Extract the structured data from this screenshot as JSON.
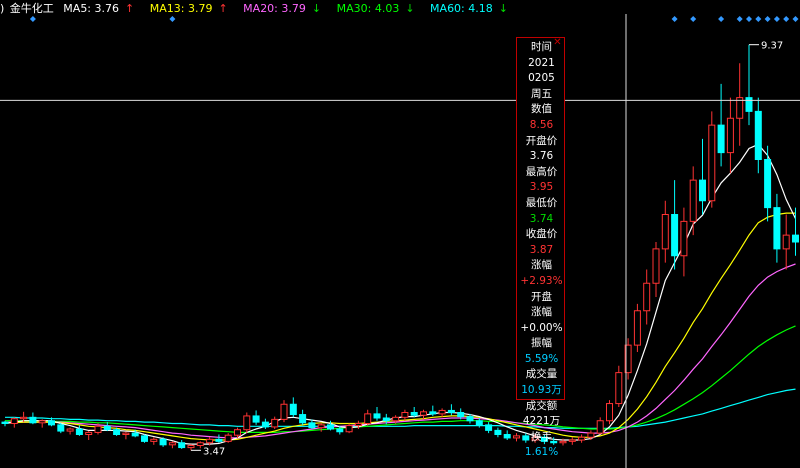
{
  "legend": {
    "prefix": ")",
    "stock_name": "金牛化工",
    "items": [
      {
        "label": "MA5: 3.76",
        "arrow": "↑",
        "color": "#ffffff"
      },
      {
        "label": "MA13: 3.79",
        "arrow": "↑",
        "color": "#ffff00"
      },
      {
        "label": "MA20: 3.79",
        "arrow": "↓",
        "color": "#ff66ff"
      },
      {
        "label": "MA30: 4.03",
        "arrow": "↓",
        "color": "#00ff00"
      },
      {
        "label": "MA60: 4.18",
        "arrow": "↓",
        "color": "#00ffff"
      }
    ]
  },
  "info_panel": {
    "close_glyph": "✕",
    "rows": [
      {
        "text": "时间",
        "color": "#ffffff"
      },
      {
        "text": "2021",
        "color": "#ffffff"
      },
      {
        "text": "0205",
        "color": "#ffffff"
      },
      {
        "text": "周五",
        "color": "#ffffff"
      },
      {
        "text": "数值",
        "color": "#ffffff"
      },
      {
        "text": "8.56",
        "color": "#ff3333"
      },
      {
        "text": "开盘价",
        "color": "#ffffff"
      },
      {
        "text": "3.76",
        "color": "#ffffff"
      },
      {
        "text": "最高价",
        "color": "#ffffff"
      },
      {
        "text": "3.95",
        "color": "#ff3333"
      },
      {
        "text": "最低价",
        "color": "#ffffff"
      },
      {
        "text": "3.74",
        "color": "#00dd00"
      },
      {
        "text": "收盘价",
        "color": "#ffffff"
      },
      {
        "text": "3.87",
        "color": "#ff3333"
      },
      {
        "text": "涨幅",
        "color": "#ffffff"
      },
      {
        "text": "+2.93%",
        "color": "#ff3333"
      },
      {
        "text": "开盘",
        "color": "#ffffff"
      },
      {
        "text": "涨幅",
        "color": "#ffffff"
      },
      {
        "text": "+0.00%",
        "color": "#ffffff"
      },
      {
        "text": "振幅",
        "color": "#ffffff"
      },
      {
        "text": "5.59%",
        "color": "#00ccff"
      },
      {
        "text": "成交量",
        "color": "#ffffff"
      },
      {
        "text": "10.93万",
        "color": "#00ccff"
      },
      {
        "text": "成交额",
        "color": "#ffffff"
      },
      {
        "text": "4221万",
        "color": "#ffffff"
      },
      {
        "text": "换手",
        "color": "#ffffff"
      },
      {
        "text": "1.61%",
        "color": "#00ccff"
      }
    ]
  },
  "chart_data": {
    "type": "candlestick",
    "ylim": [
      3.3,
      9.7
    ],
    "crosshair_value": 8.56,
    "annotations": [
      {
        "text": "9.37",
        "value": 9.37
      },
      {
        "text": "3.47",
        "value": 3.47
      }
    ],
    "colors": {
      "up": "#ff3333",
      "down": "#00ffff",
      "ma5": "#ffffff",
      "ma13": "#ffff00",
      "ma20": "#ff66ff",
      "ma30": "#00ff00",
      "ma60": "#00ffff",
      "marker": "#3399ff",
      "crosshair": "#dddddd"
    },
    "ohlc": [
      [
        3.88,
        3.9,
        3.82,
        3.86
      ],
      [
        3.86,
        3.95,
        3.8,
        3.93
      ],
      [
        3.93,
        4.03,
        3.88,
        3.95
      ],
      [
        3.95,
        4.02,
        3.85,
        3.87
      ],
      [
        3.87,
        3.92,
        3.8,
        3.9
      ],
      [
        3.9,
        3.95,
        3.82,
        3.84
      ],
      [
        3.84,
        3.87,
        3.72,
        3.75
      ],
      [
        3.75,
        3.8,
        3.7,
        3.78
      ],
      [
        3.78,
        3.83,
        3.68,
        3.7
      ],
      [
        3.7,
        3.75,
        3.62,
        3.73
      ],
      [
        3.73,
        3.86,
        3.7,
        3.82
      ],
      [
        3.82,
        3.88,
        3.75,
        3.77
      ],
      [
        3.77,
        3.8,
        3.68,
        3.7
      ],
      [
        3.7,
        3.74,
        3.63,
        3.72
      ],
      [
        3.72,
        3.77,
        3.66,
        3.68
      ],
      [
        3.68,
        3.7,
        3.58,
        3.6
      ],
      [
        3.6,
        3.66,
        3.55,
        3.63
      ],
      [
        3.63,
        3.66,
        3.52,
        3.55
      ],
      [
        3.55,
        3.6,
        3.5,
        3.58
      ],
      [
        3.58,
        3.62,
        3.49,
        3.51
      ],
      [
        3.51,
        3.56,
        3.47,
        3.54
      ],
      [
        3.54,
        3.6,
        3.5,
        3.58
      ],
      [
        3.58,
        3.66,
        3.54,
        3.63
      ],
      [
        3.63,
        3.7,
        3.58,
        3.6
      ],
      [
        3.6,
        3.72,
        3.58,
        3.69
      ],
      [
        3.69,
        3.8,
        3.65,
        3.77
      ],
      [
        3.77,
        4.02,
        3.72,
        3.97
      ],
      [
        3.97,
        4.05,
        3.84,
        3.88
      ],
      [
        3.88,
        3.93,
        3.78,
        3.81
      ],
      [
        3.81,
        3.96,
        3.78,
        3.92
      ],
      [
        3.92,
        4.2,
        3.88,
        4.14
      ],
      [
        4.14,
        4.24,
        3.95,
        3.99
      ],
      [
        3.99,
        4.06,
        3.84,
        3.87
      ],
      [
        3.87,
        3.92,
        3.78,
        3.8
      ],
      [
        3.8,
        3.87,
        3.74,
        3.84
      ],
      [
        3.84,
        3.9,
        3.76,
        3.78
      ],
      [
        3.78,
        3.82,
        3.7,
        3.74
      ],
      [
        3.74,
        3.86,
        3.72,
        3.83
      ],
      [
        3.83,
        3.9,
        3.78,
        3.86
      ],
      [
        3.86,
        4.06,
        3.83,
        4.0
      ],
      [
        4.0,
        4.1,
        3.9,
        3.94
      ],
      [
        3.94,
        4.0,
        3.85,
        3.9
      ],
      [
        3.9,
        3.98,
        3.86,
        3.95
      ],
      [
        3.95,
        4.06,
        3.9,
        4.02
      ],
      [
        4.02,
        4.1,
        3.95,
        3.98
      ],
      [
        3.98,
        4.06,
        3.92,
        4.03
      ],
      [
        4.03,
        4.12,
        3.97,
        4.0
      ],
      [
        4.0,
        4.08,
        3.95,
        4.05
      ],
      [
        4.05,
        4.14,
        3.98,
        4.02
      ],
      [
        4.02,
        4.08,
        3.92,
        3.96
      ],
      [
        3.96,
        4.0,
        3.86,
        3.9
      ],
      [
        3.9,
        3.94,
        3.8,
        3.84
      ],
      [
        3.84,
        3.88,
        3.72,
        3.76
      ],
      [
        3.76,
        3.8,
        3.66,
        3.7
      ],
      [
        3.7,
        3.76,
        3.62,
        3.65
      ],
      [
        3.65,
        3.72,
        3.6,
        3.68
      ],
      [
        3.68,
        3.72,
        3.58,
        3.62
      ],
      [
        3.62,
        3.7,
        3.58,
        3.66
      ],
      [
        3.66,
        3.7,
        3.56,
        3.6
      ],
      [
        3.6,
        3.66,
        3.55,
        3.58
      ],
      [
        3.58,
        3.64,
        3.54,
        3.6
      ],
      [
        3.6,
        3.66,
        3.55,
        3.62
      ],
      [
        3.62,
        3.7,
        3.58,
        3.66
      ],
      [
        3.66,
        3.76,
        3.62,
        3.72
      ],
      [
        3.72,
        3.95,
        3.7,
        3.9
      ],
      [
        3.9,
        4.2,
        3.85,
        4.15
      ],
      [
        4.15,
        4.7,
        4.1,
        4.6
      ],
      [
        4.6,
        5.1,
        4.5,
        5.0
      ],
      [
        5.0,
        5.6,
        4.9,
        5.5
      ],
      [
        5.5,
        6.1,
        5.3,
        5.9
      ],
      [
        5.9,
        6.5,
        5.7,
        6.4
      ],
      [
        6.4,
        7.1,
        6.2,
        6.9
      ],
      [
        6.9,
        7.4,
        6.1,
        6.3
      ],
      [
        6.3,
        7.0,
        6.0,
        6.8
      ],
      [
        6.8,
        7.6,
        6.6,
        7.4
      ],
      [
        7.4,
        8.0,
        6.9,
        7.1
      ],
      [
        7.1,
        8.4,
        7.0,
        8.2
      ],
      [
        8.2,
        8.8,
        7.6,
        7.8
      ],
      [
        7.8,
        8.6,
        7.5,
        8.3
      ],
      [
        8.3,
        9.1,
        7.9,
        8.6
      ],
      [
        8.6,
        9.37,
        8.2,
        8.4
      ],
      [
        8.4,
        8.6,
        7.5,
        7.7
      ],
      [
        7.7,
        7.9,
        6.8,
        7.0
      ],
      [
        7.0,
        7.2,
        6.2,
        6.4
      ],
      [
        6.4,
        6.9,
        6.1,
        6.6
      ],
      [
        6.6,
        7.0,
        6.3,
        6.5
      ]
    ],
    "ma5": [
      3.86,
      3.88,
      3.9,
      3.9,
      3.9,
      3.9,
      3.86,
      3.83,
      3.79,
      3.76,
      3.76,
      3.76,
      3.76,
      3.75,
      3.74,
      3.7,
      3.67,
      3.64,
      3.61,
      3.57,
      3.56,
      3.56,
      3.56,
      3.57,
      3.61,
      3.65,
      3.73,
      3.78,
      3.82,
      3.89,
      3.94,
      3.95,
      3.93,
      3.91,
      3.89,
      3.86,
      3.81,
      3.8,
      3.81,
      3.85,
      3.87,
      3.91,
      3.94,
      3.96,
      3.96,
      3.98,
      4.0,
      4.02,
      4.02,
      4.01,
      3.99,
      3.96,
      3.92,
      3.87,
      3.81,
      3.76,
      3.72,
      3.68,
      3.65,
      3.63,
      3.62,
      3.62,
      3.62,
      3.64,
      3.7,
      3.81,
      3.98,
      4.27,
      4.63,
      5.02,
      5.48,
      5.94,
      6.2,
      6.46,
      6.76,
      6.89,
      7.14,
      7.36,
      7.5,
      7.66,
      7.86,
      7.92,
      7.76,
      7.48,
      7.12,
      6.84
    ],
    "ma13": [
      3.87,
      3.87,
      3.88,
      3.88,
      3.88,
      3.88,
      3.87,
      3.86,
      3.84,
      3.82,
      3.81,
      3.8,
      3.79,
      3.77,
      3.76,
      3.74,
      3.72,
      3.7,
      3.68,
      3.66,
      3.64,
      3.63,
      3.62,
      3.62,
      3.62,
      3.63,
      3.66,
      3.69,
      3.72,
      3.75,
      3.79,
      3.82,
      3.84,
      3.86,
      3.87,
      3.87,
      3.86,
      3.86,
      3.86,
      3.87,
      3.88,
      3.89,
      3.9,
      3.91,
      3.92,
      3.93,
      3.95,
      3.96,
      3.97,
      3.97,
      3.96,
      3.95,
      3.93,
      3.9,
      3.87,
      3.84,
      3.81,
      3.78,
      3.75,
      3.72,
      3.69,
      3.67,
      3.66,
      3.66,
      3.68,
      3.72,
      3.8,
      3.92,
      4.07,
      4.25,
      4.46,
      4.69,
      4.89,
      5.1,
      5.33,
      5.53,
      5.76,
      5.97,
      6.17,
      6.38,
      6.6,
      6.78,
      6.86,
      6.9,
      6.92,
      6.92
    ],
    "ma20": [
      3.88,
      3.88,
      3.88,
      3.88,
      3.88,
      3.88,
      3.88,
      3.87,
      3.86,
      3.85,
      3.84,
      3.83,
      3.82,
      3.81,
      3.8,
      3.78,
      3.76,
      3.74,
      3.72,
      3.71,
      3.69,
      3.68,
      3.67,
      3.66,
      3.65,
      3.65,
      3.66,
      3.67,
      3.68,
      3.7,
      3.72,
      3.74,
      3.76,
      3.78,
      3.8,
      3.81,
      3.82,
      3.83,
      3.84,
      3.85,
      3.86,
      3.87,
      3.88,
      3.89,
      3.9,
      3.91,
      3.92,
      3.93,
      3.94,
      3.94,
      3.94,
      3.93,
      3.92,
      3.91,
      3.89,
      3.87,
      3.85,
      3.83,
      3.8,
      3.78,
      3.76,
      3.74,
      3.73,
      3.72,
      3.72,
      3.73,
      3.76,
      3.81,
      3.88,
      3.97,
      4.08,
      4.21,
      4.34,
      4.49,
      4.65,
      4.8,
      4.98,
      5.15,
      5.33,
      5.52,
      5.71,
      5.87,
      5.99,
      6.07,
      6.13,
      6.18
    ],
    "ma30": [
      3.9,
      3.9,
      3.9,
      3.9,
      3.9,
      3.89,
      3.89,
      3.89,
      3.88,
      3.88,
      3.87,
      3.87,
      3.86,
      3.85,
      3.84,
      3.83,
      3.82,
      3.81,
      3.8,
      3.79,
      3.78,
      3.77,
      3.76,
      3.75,
      3.74,
      3.73,
      3.73,
      3.73,
      3.73,
      3.73,
      3.74,
      3.74,
      3.75,
      3.76,
      3.77,
      3.78,
      3.79,
      3.8,
      3.81,
      3.82,
      3.83,
      3.84,
      3.85,
      3.86,
      3.87,
      3.88,
      3.88,
      3.89,
      3.89,
      3.9,
      3.9,
      3.9,
      3.89,
      3.89,
      3.88,
      3.87,
      3.86,
      3.85,
      3.84,
      3.83,
      3.81,
      3.8,
      3.79,
      3.78,
      3.78,
      3.78,
      3.79,
      3.81,
      3.84,
      3.88,
      3.93,
      3.99,
      4.06,
      4.14,
      4.22,
      4.31,
      4.41,
      4.52,
      4.63,
      4.75,
      4.87,
      4.98,
      5.07,
      5.15,
      5.22,
      5.28
    ],
    "ma60": [
      3.95,
      3.95,
      3.94,
      3.94,
      3.94,
      3.93,
      3.93,
      3.92,
      3.92,
      3.91,
      3.91,
      3.9,
      3.9,
      3.89,
      3.89,
      3.88,
      3.88,
      3.87,
      3.86,
      3.86,
      3.85,
      3.84,
      3.84,
      3.83,
      3.83,
      3.82,
      3.82,
      3.82,
      3.82,
      3.82,
      3.82,
      3.82,
      3.82,
      3.82,
      3.82,
      3.82,
      3.82,
      3.82,
      3.82,
      3.82,
      3.82,
      3.82,
      3.82,
      3.82,
      3.83,
      3.83,
      3.83,
      3.83,
      3.83,
      3.83,
      3.83,
      3.83,
      3.83,
      3.83,
      3.82,
      3.82,
      3.81,
      3.81,
      3.8,
      3.8,
      3.79,
      3.79,
      3.79,
      3.79,
      3.79,
      3.79,
      3.8,
      3.81,
      3.82,
      3.84,
      3.86,
      3.88,
      3.91,
      3.94,
      3.97,
      4.0,
      4.04,
      4.08,
      4.12,
      4.16,
      4.2,
      4.24,
      4.28,
      4.31,
      4.34,
      4.36
    ],
    "top_markers": [
      3,
      18,
      72,
      74,
      77,
      79,
      80,
      81,
      82,
      83,
      84,
      85,
      87
    ]
  }
}
